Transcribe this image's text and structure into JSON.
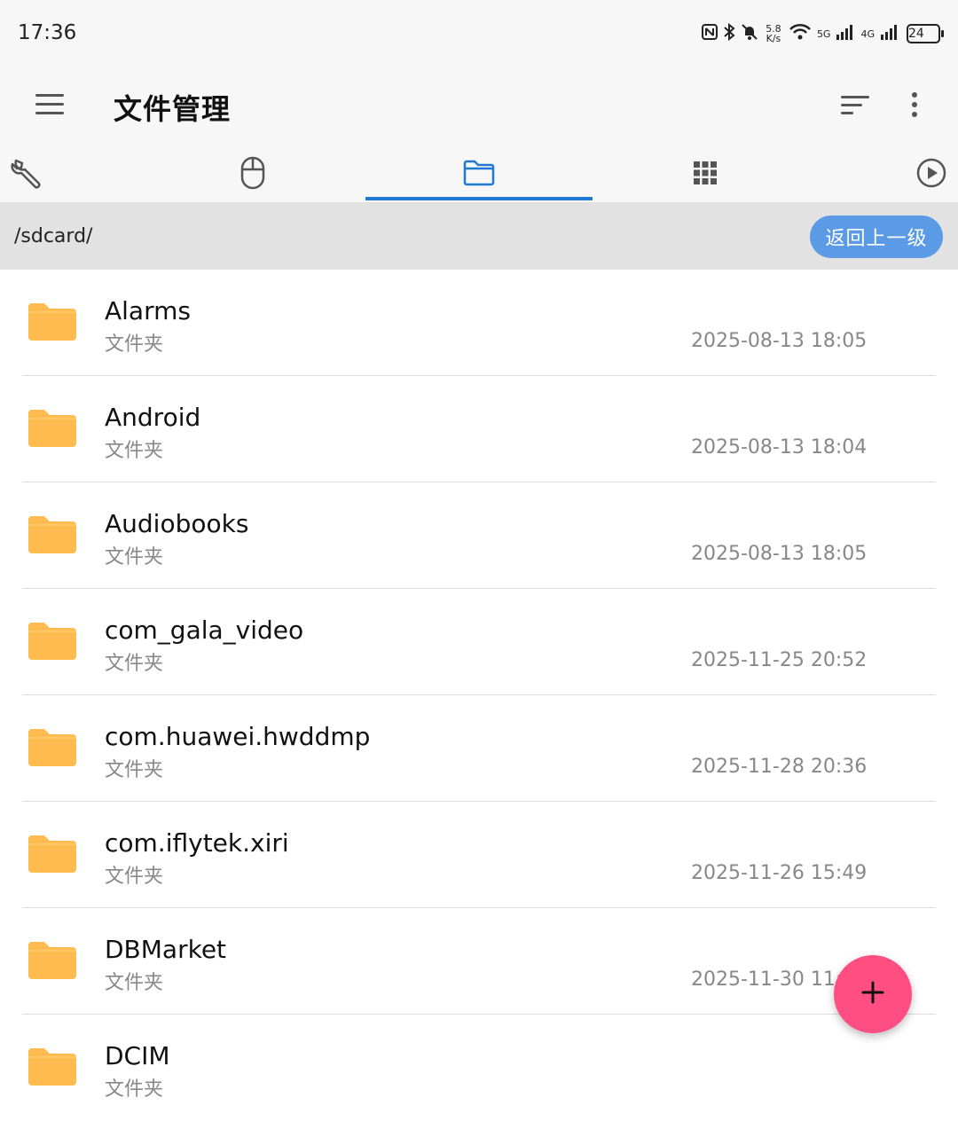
{
  "status_bar": {
    "time": "17:36",
    "net_speed": "5.8 K/s",
    "sig5g": "5G",
    "sig4g": "4G",
    "battery": "24"
  },
  "app_bar": {
    "title": "文件管理"
  },
  "tabs": [
    {
      "icon": "wrench-icon"
    },
    {
      "icon": "mouse-icon"
    },
    {
      "icon": "folder-icon",
      "active": true
    },
    {
      "icon": "grid-icon"
    },
    {
      "icon": "play-circle-icon"
    }
  ],
  "path_bar": {
    "path": "/sdcard/",
    "back_label": "返回上一级"
  },
  "files": [
    {
      "name": "Alarms",
      "type": "文件夹",
      "date": "2025-08-13 18:05"
    },
    {
      "name": "Android",
      "type": "文件夹",
      "date": "2025-08-13 18:04"
    },
    {
      "name": "Audiobooks",
      "type": "文件夹",
      "date": "2025-08-13 18:05"
    },
    {
      "name": "com_gala_video",
      "type": "文件夹",
      "date": "2025-11-25 20:52"
    },
    {
      "name": "com.huawei.hwddmp",
      "type": "文件夹",
      "date": "2025-11-28 20:36"
    },
    {
      "name": "com.iflytek.xiri",
      "type": "文件夹",
      "date": "2025-11-26 15:49"
    },
    {
      "name": "DBMarket",
      "type": "文件夹",
      "date": "2025-11-30 11:5"
    },
    {
      "name": "DCIM",
      "type": "文件夹",
      "date": ""
    }
  ],
  "colors": {
    "accent": "#1f78d1",
    "folder": "#ffbb4d",
    "fab": "#ff4f82",
    "back_button": "#5b9be6"
  }
}
